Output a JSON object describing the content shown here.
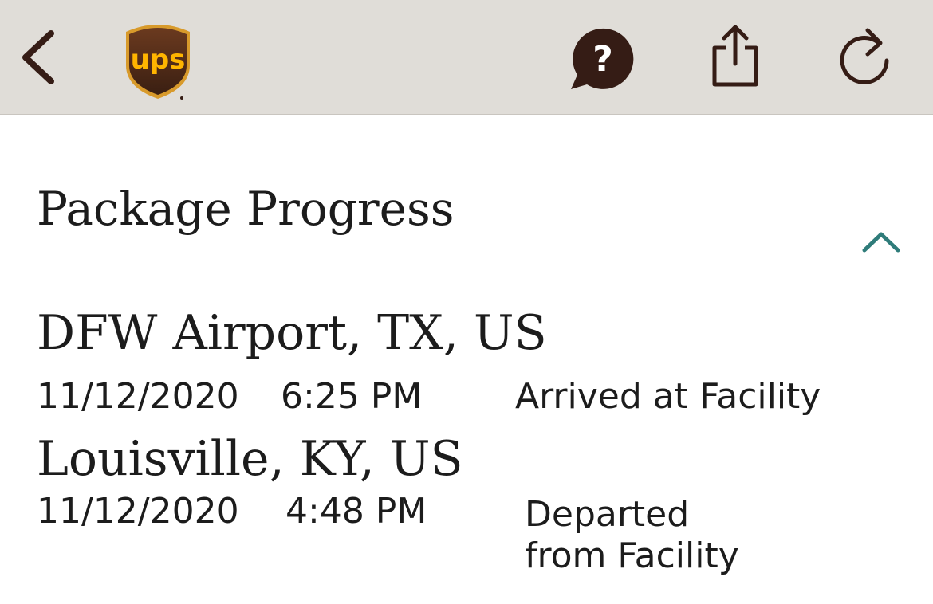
{
  "header": {
    "back_icon": "chevron-left-icon",
    "logo_text": "ups",
    "help_icon": "question-bubble-icon",
    "share_icon": "share-icon",
    "refresh_icon": "refresh-icon",
    "colors": {
      "bar_background": "#e0ddd8",
      "icon": "#351c15",
      "logo_brown": "#351c15",
      "logo_gold": "#ffb500"
    }
  },
  "main": {
    "title": "Package Progress",
    "collapse_icon": "chevron-up-icon",
    "accent_color": "#2f7c7a",
    "events": [
      {
        "location": "DFW Airport, TX, US",
        "date": "11/12/2020",
        "time": "6:25 PM",
        "status": "Arrived at Facility"
      },
      {
        "location": "Louisville, KY, US",
        "date": "11/12/2020",
        "time": "4:48 PM",
        "status": "Departed from Facility"
      }
    ]
  }
}
